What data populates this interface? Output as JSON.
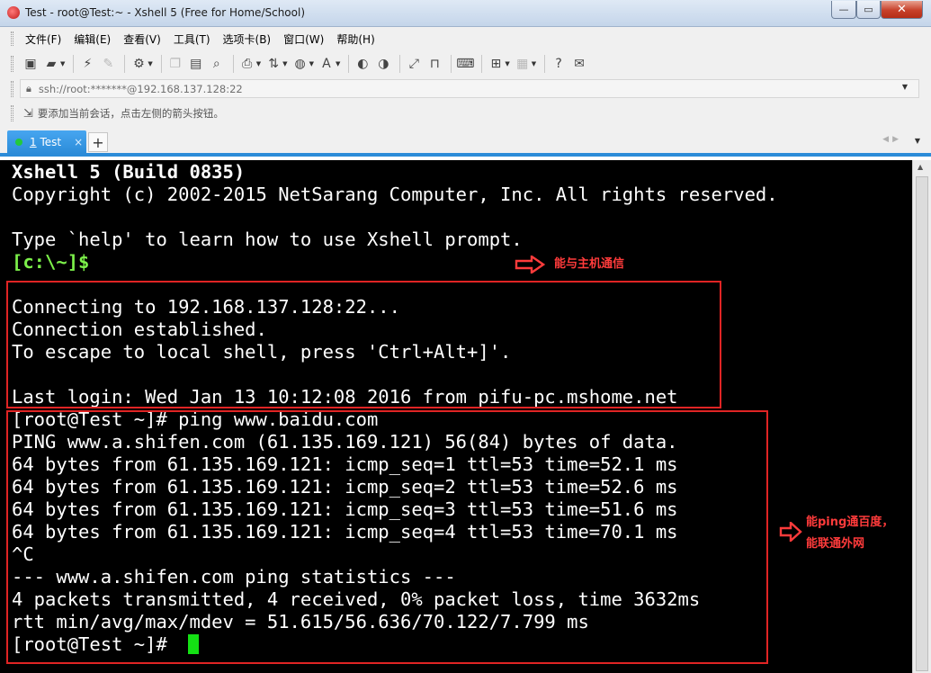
{
  "window": {
    "title": "Test - root@Test:~ - Xshell 5 (Free for Home/School)",
    "minimize": "—",
    "maximize": "▭",
    "close": "✕"
  },
  "menu": [
    "文件(F)",
    "编辑(E)",
    "查看(V)",
    "工具(T)",
    "选项卡(B)",
    "窗口(W)",
    "帮助(H)"
  ],
  "address": {
    "value": "ssh://root:*******@192.168.137.128:22"
  },
  "hint": "要添加当前会话，点击左侧的箭头按钮。",
  "tabs": [
    {
      "number": "1",
      "label": "Test",
      "active": true
    }
  ],
  "tab_add": "+",
  "terminal": {
    "lines": [
      "Xshell 5 (Build 0835)",
      "Copyright (c) 2002-2015 NetSarang Computer, Inc. All rights reserved.",
      "",
      "Type `help' to learn how to use Xshell prompt.",
      "[c:\\~]$",
      "",
      "Connecting to 192.168.137.128:22...",
      "Connection established.",
      "To escape to local shell, press 'Ctrl+Alt+]'.",
      "",
      "Last login: Wed Jan 13 10:12:08 2016 from pifu-pc.mshome.net",
      "[root@Test ~]# ping www.baidu.com",
      "PING www.a.shifen.com (61.135.169.121) 56(84) bytes of data.",
      "64 bytes from 61.135.169.121: icmp_seq=1 ttl=53 time=52.1 ms",
      "64 bytes from 61.135.169.121: icmp_seq=2 ttl=53 time=52.6 ms",
      "64 bytes from 61.135.169.121: icmp_seq=3 ttl=53 time=51.6 ms",
      "64 bytes from 61.135.169.121: icmp_seq=4 ttl=53 time=70.1 ms",
      "^C",
      "--- www.a.shifen.com ping statistics ---",
      "4 packets transmitted, 4 received, 0% packet loss, time 3632ms",
      "rtt min/avg/max/mdev = 51.615/56.636/70.122/7.799 ms",
      "[root@Test ~]# "
    ],
    "background": "#000000",
    "text_color": "#ffffff",
    "prompt_color": "#7cf04a",
    "cursor_color": "#14e014"
  },
  "annotations": {
    "host_note": "能与主机通信",
    "ping_note_line1": "能ping通百度，",
    "ping_note_line2": "能联通外网",
    "color": "#e02424"
  }
}
